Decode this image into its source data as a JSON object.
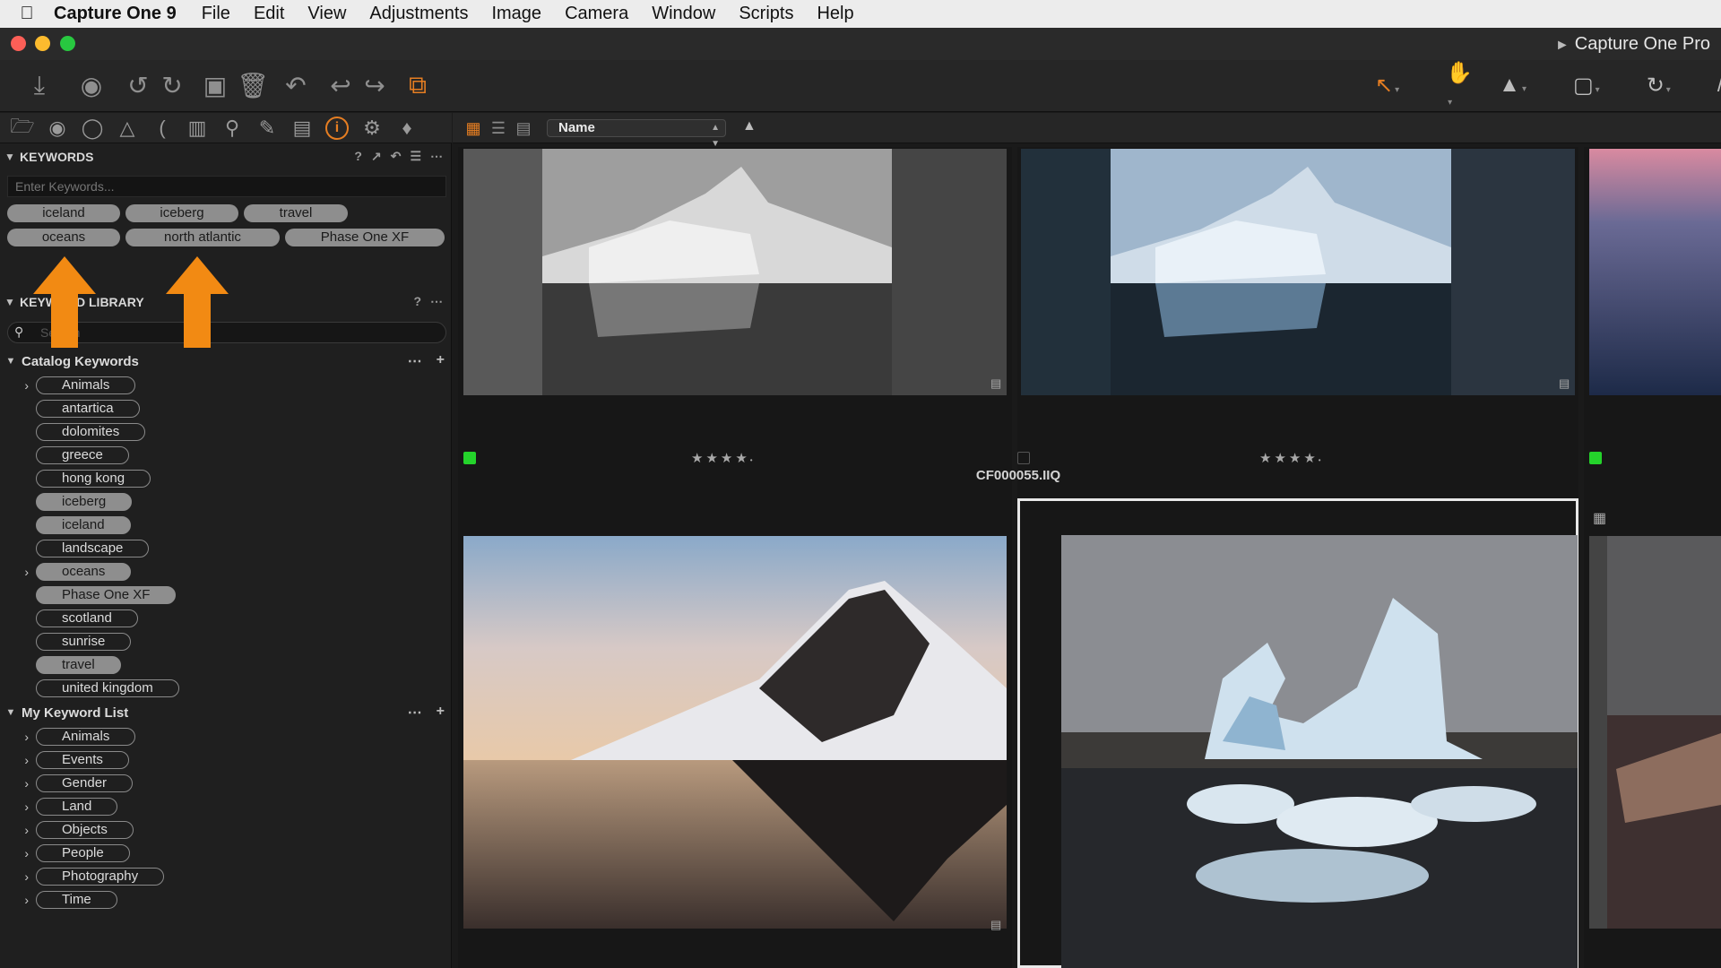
{
  "menubar": {
    "app_name": "Capture One 9",
    "items": [
      "File",
      "Edit",
      "View",
      "Adjustments",
      "Image",
      "Camera",
      "Window",
      "Scripts",
      "Help"
    ]
  },
  "window": {
    "title": "Capture One Pro"
  },
  "keywords_panel": {
    "title": "KEYWORDS",
    "input_placeholder": "Enter Keywords...",
    "tags": [
      "iceland",
      "iceberg",
      "travel",
      "oceans",
      "north atlantic",
      "Phase One XF"
    ]
  },
  "library_panel": {
    "title": "KEYWORD LIBRARY",
    "search_placeholder": "Search",
    "catalog_title": "Catalog Keywords",
    "catalog_items": [
      "Animals",
      "antartica",
      "dolomites",
      "greece",
      "hong kong",
      "iceberg",
      "iceland",
      "landscape",
      "oceans",
      "Phase One XF",
      "scotland",
      "sunrise",
      "travel",
      "united kingdom"
    ],
    "mylist_title": "My Keyword List",
    "mylist_items": [
      "Animals",
      "Events",
      "Gender",
      "Land",
      "Objects",
      "People",
      "Photography",
      "Time"
    ]
  },
  "browser": {
    "sort_by": "Name",
    "selected_filename": "CF000055.IIQ",
    "ratings": [
      4,
      4
    ]
  },
  "colors": {
    "accent": "#e67e22",
    "arrow": "#f28a13",
    "green_tag": "#24d32b"
  }
}
